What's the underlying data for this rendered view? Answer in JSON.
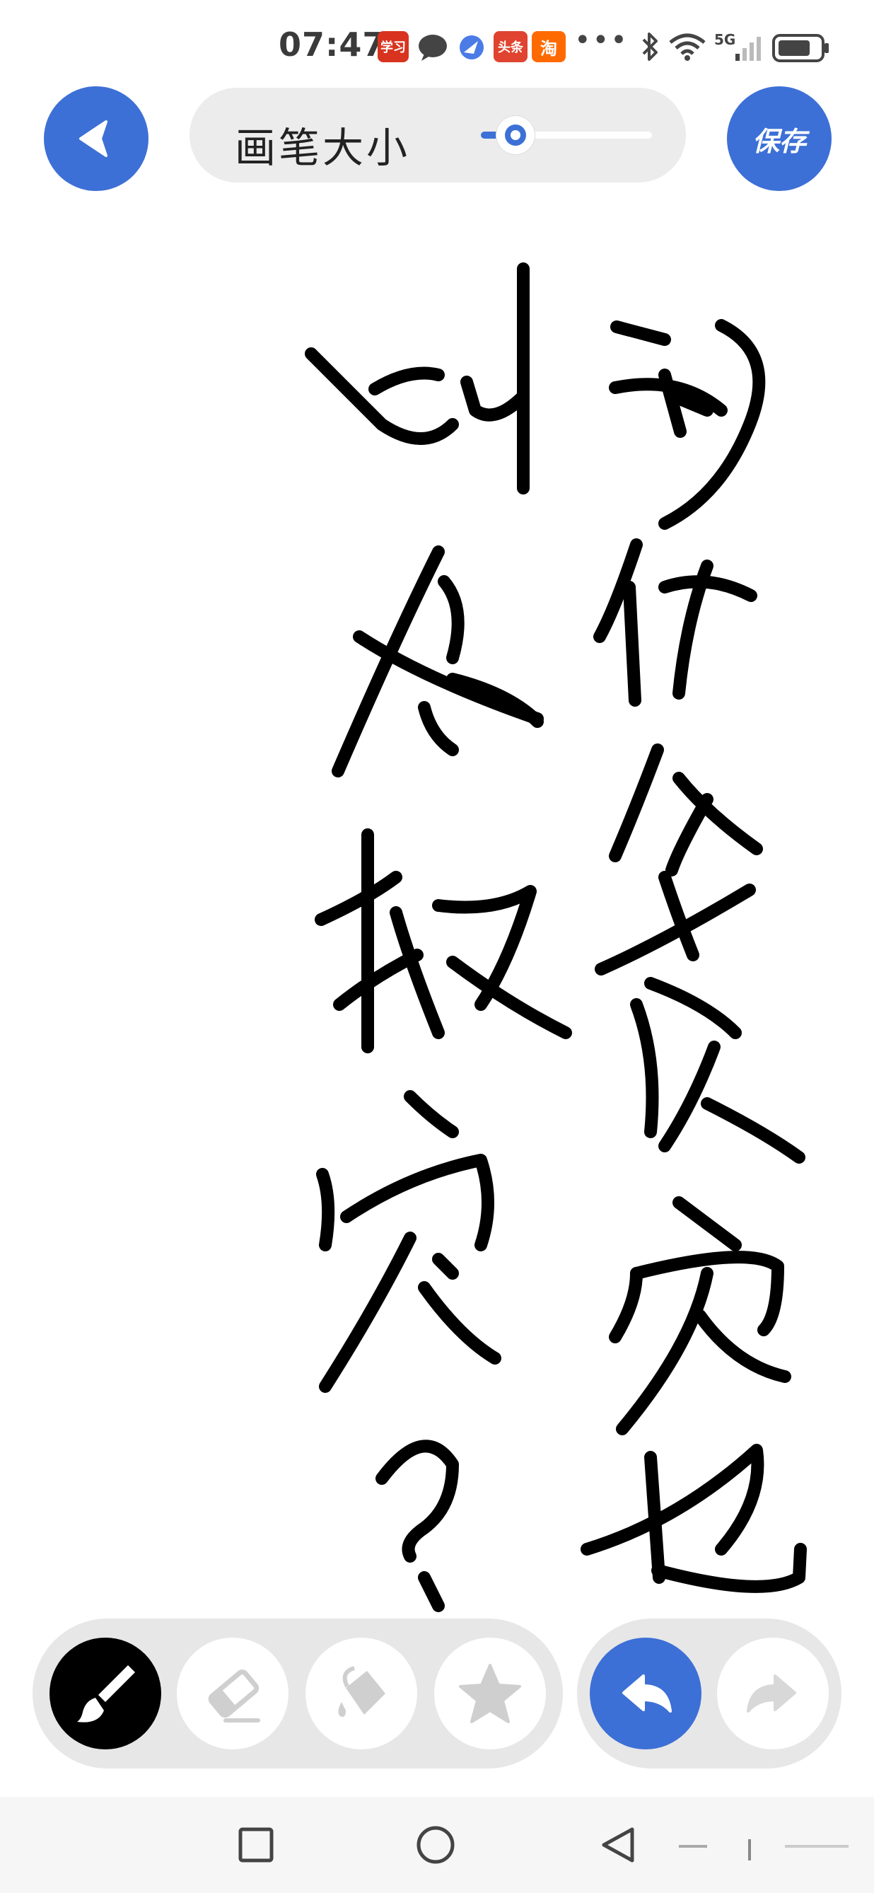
{
  "status_bar": {
    "time": "07:47",
    "app_badges": [
      {
        "name": "xuexi-app",
        "text": "学习",
        "color": "#d8331e"
      },
      {
        "name": "toutiao-app",
        "text": "头条",
        "color": "#e0432f"
      },
      {
        "name": "taobao-app",
        "text": "淘",
        "color": "#ff6a00"
      }
    ],
    "network": "5G"
  },
  "header": {
    "brush_size_label": "画笔大小",
    "brush_size_value": 0.15,
    "save_label": "保存"
  },
  "toolbar": {
    "tools": [
      {
        "name": "brush-tool",
        "icon": "brush-icon",
        "active": true
      },
      {
        "name": "eraser-tool",
        "icon": "eraser-icon",
        "active": false
      },
      {
        "name": "fill-tool",
        "icon": "paint-bucket-icon",
        "active": false
      },
      {
        "name": "sticker-tool",
        "icon": "star-icon",
        "active": false
      }
    ],
    "history": [
      {
        "name": "undo-button",
        "icon": "undo-icon",
        "enabled": true
      },
      {
        "name": "redo-button",
        "icon": "redo-icon",
        "enabled": false
      }
    ]
  },
  "colors": {
    "accent": "#3d70d6",
    "ink": "#000000",
    "pill_bg": "#ececec"
  },
  "nav_bar": [
    "square-icon",
    "circle-icon",
    "triangle-icon"
  ]
}
